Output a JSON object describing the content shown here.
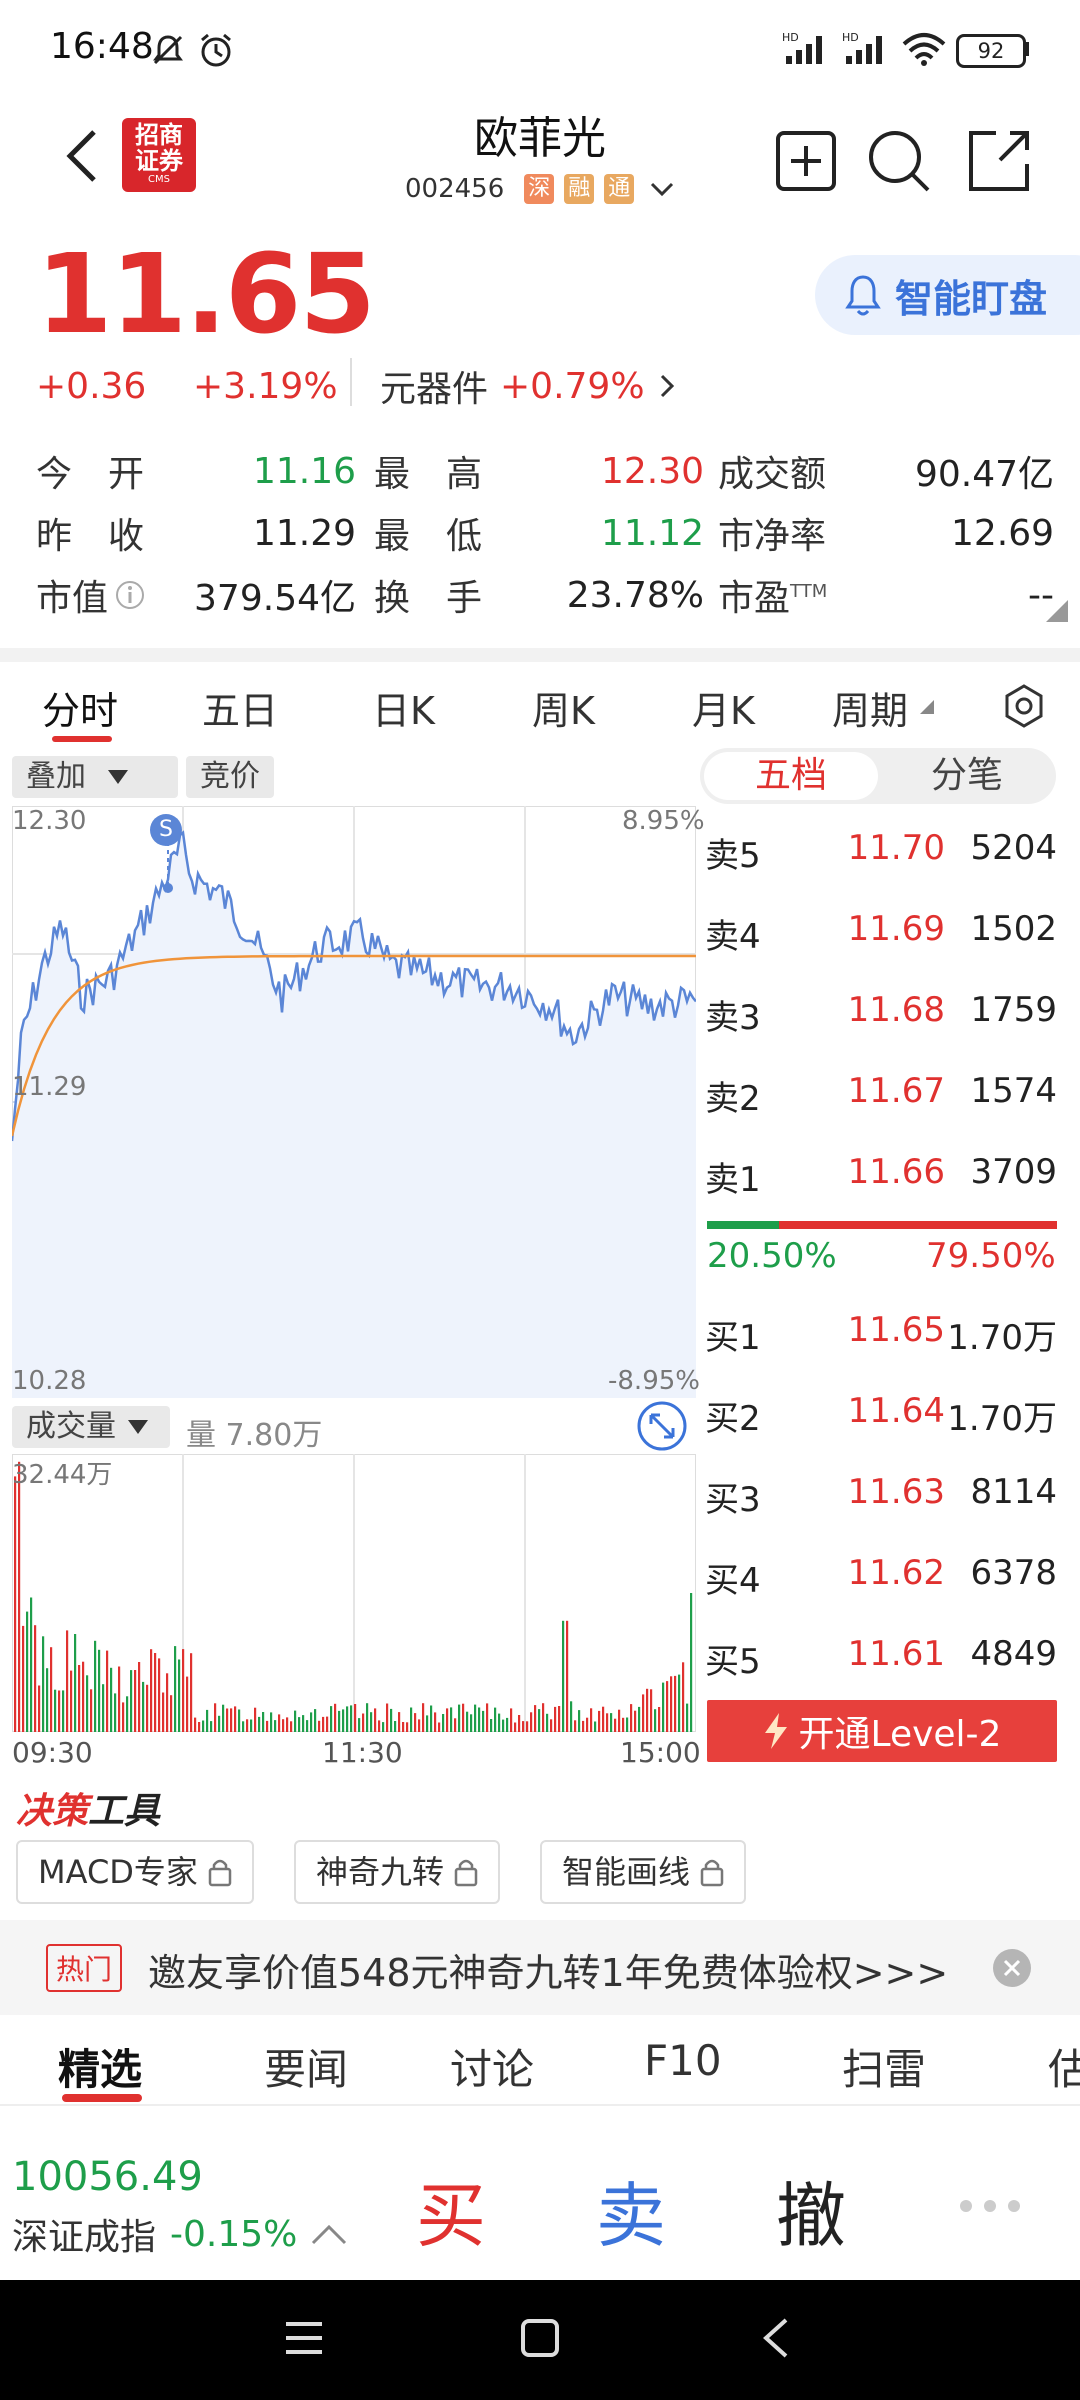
{
  "status": {
    "time": "16:48",
    "battery": "92"
  },
  "header": {
    "stock_name": "欧菲光",
    "stock_code": "002456",
    "tags": [
      {
        "text": "深",
        "color": "#f08a5d"
      },
      {
        "text": "融",
        "color": "#e8a860"
      },
      {
        "text": "通",
        "color": "#e8a860"
      }
    ],
    "logo_line1": "招商",
    "logo_line2": "证券",
    "logo_sub": "CMS"
  },
  "quote": {
    "price": "11.65",
    "change": "+0.36",
    "change_pct": "+3.19%",
    "sector": "元器件",
    "sector_pct": "+0.79%",
    "smart_watch": "智能盯盘"
  },
  "stats": {
    "r1": {
      "l1": "今　开",
      "v1": "11.16",
      "l2": "最　高",
      "v2": "12.30",
      "l3": "成交额",
      "v3": "90.47亿"
    },
    "r2": {
      "l1": "昨　收",
      "v1": "11.29",
      "l2": "最　低",
      "v2": "11.12",
      "l3": "市净率",
      "v3": "12.69"
    },
    "r3": {
      "l1": "市值",
      "v1": "379.54亿",
      "l2": "换　手",
      "v2": "23.78%",
      "l3": "市盈",
      "l3sup": "TTM",
      "v3": "--"
    }
  },
  "tabs": {
    "t1": "分时",
    "t2": "五日",
    "t3": "日K",
    "t4": "周K",
    "t5": "月K",
    "t6": "周期"
  },
  "chart": {
    "overlay": "叠加",
    "auction": "竞价",
    "y_top": "12.30",
    "y_mid": "11.29",
    "y_bottom": "10.28",
    "pct_top": "8.95%",
    "pct_bottom": "-8.95%",
    "volume_label": "成交量",
    "volume_now": "量 7.80万",
    "volume_max": "32.44万",
    "x_start": "09:30",
    "x_mid": "11:30",
    "x_end": "15:00",
    "marker": "S"
  },
  "orderbook": {
    "tab_five": "五档",
    "tab_ticks": "分笔",
    "asks": [
      {
        "label": "卖5",
        "price": "11.70",
        "vol": "5204"
      },
      {
        "label": "卖4",
        "price": "11.69",
        "vol": "1502"
      },
      {
        "label": "卖3",
        "price": "11.68",
        "vol": "1759"
      },
      {
        "label": "卖2",
        "price": "11.67",
        "vol": "1574"
      },
      {
        "label": "卖1",
        "price": "11.66",
        "vol": "3709"
      }
    ],
    "buy_ratio": "20.50%",
    "sell_ratio": "79.50%",
    "buy_fraction": 0.205,
    "bids": [
      {
        "label": "买1",
        "price": "11.65",
        "vol": "1.70万"
      },
      {
        "label": "买2",
        "price": "11.64",
        "vol": "1.70万"
      },
      {
        "label": "买3",
        "price": "11.63",
        "vol": "8114"
      },
      {
        "label": "买4",
        "price": "11.62",
        "vol": "6378"
      },
      {
        "label": "买5",
        "price": "11.61",
        "vol": "4849"
      }
    ],
    "level2": "开通Level-2"
  },
  "tools": {
    "title_a": "决策",
    "title_b": "工具",
    "items": [
      "MACD专家",
      "神奇九转",
      "智能画线"
    ]
  },
  "banner": {
    "tag": "热门",
    "text": "邀友享价值548元神奇九转1年免费体验权>>>"
  },
  "news_tabs": {
    "n1": "精选",
    "n2": "要闻",
    "n3": "讨论",
    "n4": "F10",
    "n5": "扫雷",
    "n6": "估"
  },
  "bottom": {
    "index_value": "10056.49",
    "index_name": "深证成指",
    "index_pct": "-0.15%",
    "buy": "买",
    "sell": "卖",
    "cancel": "撤"
  },
  "colors": {
    "up": "#e0312f",
    "down": "#1e9e4a",
    "line": "#5b86d6",
    "avg": "#f0943a"
  }
}
